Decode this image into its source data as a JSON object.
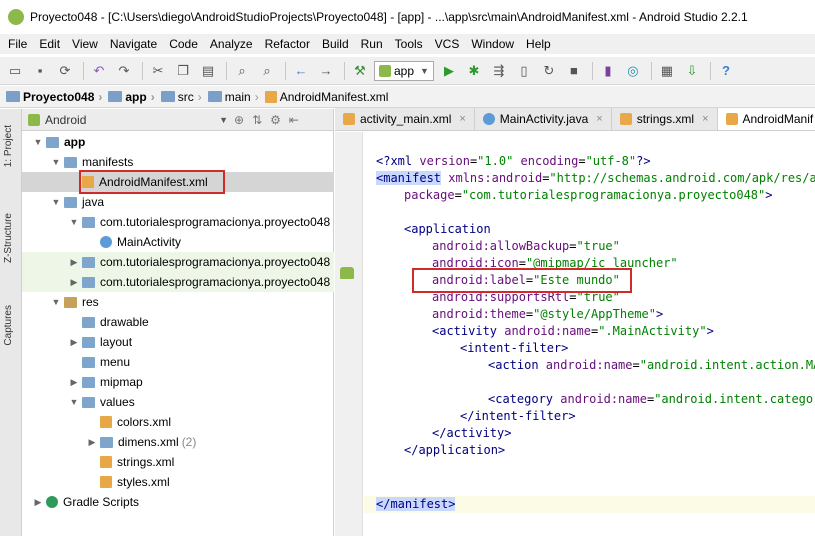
{
  "window": {
    "title": "Proyecto048 - [C:\\Users\\diego\\AndroidStudioProjects\\Proyecto048] - [app] - ...\\app\\src\\main\\AndroidManifest.xml - Android Studio 2.2.1"
  },
  "menu": [
    "File",
    "Edit",
    "View",
    "Navigate",
    "Code",
    "Analyze",
    "Refactor",
    "Build",
    "Run",
    "Tools",
    "VCS",
    "Window",
    "Help"
  ],
  "toolbar": {
    "run_config": "app"
  },
  "breadcrumb": [
    "Proyecto048",
    "app",
    "src",
    "main",
    "AndroidManifest.xml"
  ],
  "side_tabs": [
    "1: Project",
    "Z-Structure",
    "Captures"
  ],
  "project_pane": {
    "view": "Android",
    "tree": [
      {
        "label": "app",
        "arrow": "▼",
        "icon": "folder",
        "bold": true
      },
      {
        "label": "manifests",
        "arrow": "▼",
        "icon": "folder"
      },
      {
        "label": "AndroidManifest.xml",
        "arrow": "",
        "icon": "xml"
      },
      {
        "label": "java",
        "arrow": "▼",
        "icon": "folder"
      },
      {
        "label": "com.tutorialesprogramacionya.proyecto048",
        "arrow": "▼",
        "icon": "folder"
      },
      {
        "label": "MainActivity",
        "arrow": "",
        "icon": "java-class"
      },
      {
        "label": "com.tutorialesprogramacionya.proyecto048",
        "arrow": "▶",
        "icon": "folder"
      },
      {
        "label": "com.tutorialesprogramacionya.proyecto048",
        "arrow": "▶",
        "icon": "folder"
      },
      {
        "label": "res",
        "arrow": "▼",
        "icon": "res"
      },
      {
        "label": "drawable",
        "arrow": "",
        "icon": "folder"
      },
      {
        "label": "layout",
        "arrow": "▶",
        "icon": "folder"
      },
      {
        "label": "menu",
        "arrow": "",
        "icon": "folder"
      },
      {
        "label": "mipmap",
        "arrow": "▶",
        "icon": "folder"
      },
      {
        "label": "values",
        "arrow": "▼",
        "icon": "folder"
      },
      {
        "label": "colors.xml",
        "arrow": "",
        "icon": "xml"
      },
      {
        "label": "dimens.xml",
        "arrow": "▶",
        "icon": "folder",
        "count": "(2)"
      },
      {
        "label": "strings.xml",
        "arrow": "",
        "icon": "xml"
      },
      {
        "label": "styles.xml",
        "arrow": "",
        "icon": "xml"
      },
      {
        "label": "Gradle Scripts",
        "arrow": "▶",
        "icon": "gradle"
      }
    ]
  },
  "editor": {
    "tabs": [
      {
        "label": "activity_main.xml",
        "icon": "xml"
      },
      {
        "label": "MainActivity.java",
        "icon": "java"
      },
      {
        "label": "strings.xml",
        "icon": "xml"
      },
      {
        "label": "AndroidManif",
        "icon": "xml"
      }
    ],
    "code": {
      "l1": {
        "a": "<?xml ",
        "b": "version",
        "c": "=",
        "d": "\"1.0\"",
        "e": " encoding",
        "f": "=",
        "g": "\"utf-8\"",
        "h": "?>"
      },
      "l2": {
        "a": "<manifest",
        "b": " xmlns:android",
        "c": "=",
        "d": "\"http://schemas.android.com/apk/res/and"
      },
      "l3": {
        "a": "package",
        "b": "=",
        "c": "\"com.tutorialesprogramacionya.proyecto048\"",
        "d": ">"
      },
      "l4": {
        "a": "<application"
      },
      "l5": {
        "a": "android:allowBackup",
        "b": "=",
        "c": "\"true\""
      },
      "l6": {
        "a": "android:icon",
        "b": "=",
        "c": "\"@mipmap/ic_launcher\""
      },
      "l7": {
        "a": "android:label",
        "b": "=",
        "c": "\"Este mundo\""
      },
      "l8": {
        "a": "android:supportsRtl",
        "b": "=",
        "c": "\"true\""
      },
      "l9": {
        "a": "android:theme",
        "b": "=",
        "c": "\"@style/AppTheme\"",
        "d": ">"
      },
      "l10": {
        "a": "<activity",
        "b": " android:name",
        "c": "=",
        "d": "\".MainActivity\"",
        "e": ">"
      },
      "l11": {
        "a": "<intent-filter>"
      },
      "l12": {
        "a": "<action",
        "b": " android:name",
        "c": "=",
        "d": "\"android.intent.action.MAI"
      },
      "l13": {
        "a": "<category",
        "b": " android:name",
        "c": "=",
        "d": "\"android.intent.category"
      },
      "l14": {
        "a": "</intent-filter>"
      },
      "l15": {
        "a": "</activity>"
      },
      "l16": {
        "a": "</application>"
      },
      "l17": {
        "a": "</manifest>"
      }
    }
  }
}
